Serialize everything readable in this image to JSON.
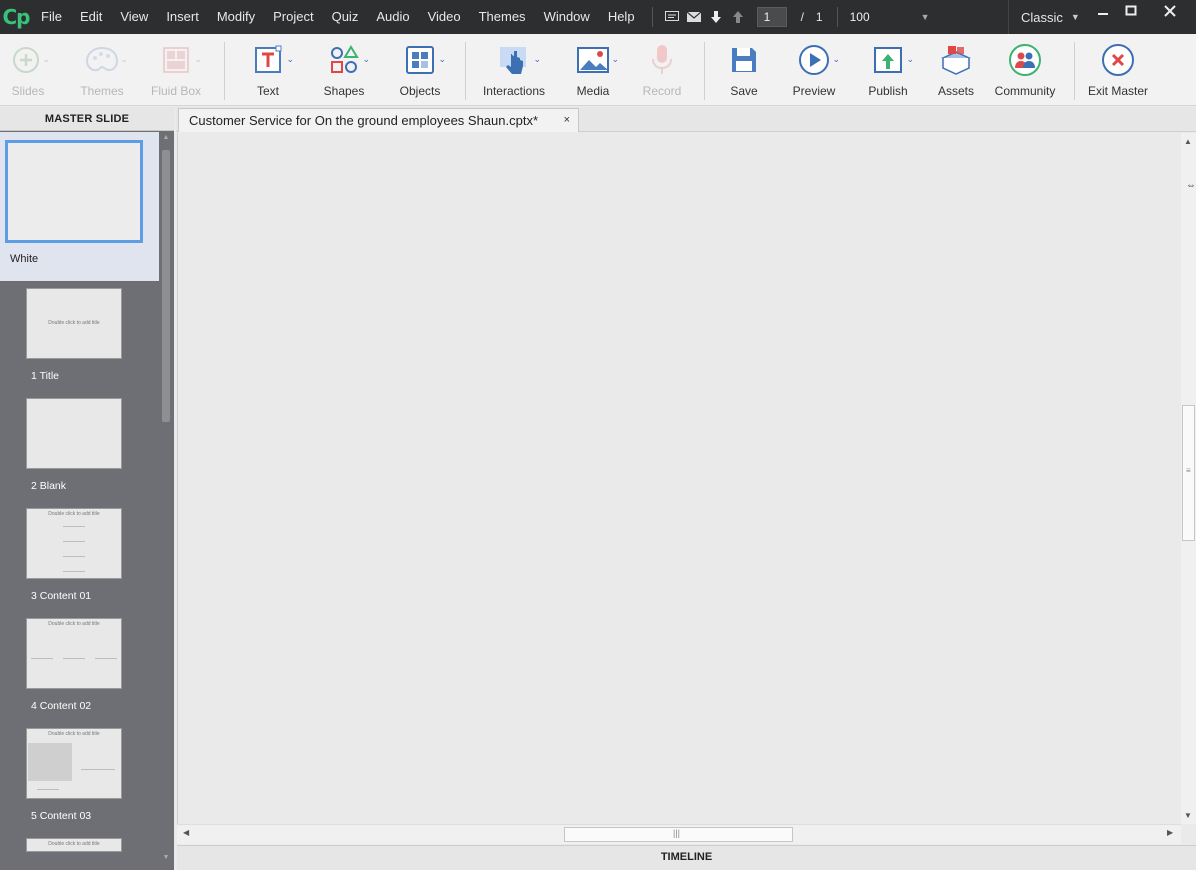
{
  "app": {
    "logo": "Cp"
  },
  "menu": [
    "File",
    "Edit",
    "View",
    "Insert",
    "Modify",
    "Project",
    "Quiz",
    "Audio",
    "Video",
    "Themes",
    "Window",
    "Help"
  ],
  "menubar": {
    "current_slide": "1",
    "slide_separator": "/",
    "total_slides": "1",
    "zoom": "100",
    "workspace": "Classic"
  },
  "toolbar": {
    "slides": "Slides",
    "themes": "Themes",
    "fluid_box": "Fluid Box",
    "text": "Text",
    "shapes": "Shapes",
    "objects": "Objects",
    "interactions": "Interactions",
    "media": "Media",
    "record": "Record",
    "save": "Save",
    "preview": "Preview",
    "publish": "Publish",
    "assets": "Assets",
    "community": "Community",
    "exit_master": "Exit Master"
  },
  "left_panel": {
    "header": "MASTER SLIDE",
    "master_label": "White",
    "layouts": [
      {
        "label": "1 Title",
        "title_text": "Double click to add title"
      },
      {
        "label": "2 Blank"
      },
      {
        "label": "3 Content 01",
        "title_text": "Double click to add title"
      },
      {
        "label": "4 Content 02",
        "title_text": "Double click to add title"
      },
      {
        "label": "5 Content 03",
        "title_text": "Double click to add title"
      },
      {
        "label": "",
        "title_text": "Double click to add title"
      }
    ]
  },
  "document_tab": {
    "title": "Customer Service for On the ground employees Shaun.cptx*",
    "close": "×"
  },
  "timeline": {
    "label": "TIMELINE"
  },
  "colors": {
    "menubar_bg": "#2d2e30",
    "logo": "#37c37a",
    "accent_blue": "#3d6fb5",
    "selection": "#5d9de5"
  }
}
